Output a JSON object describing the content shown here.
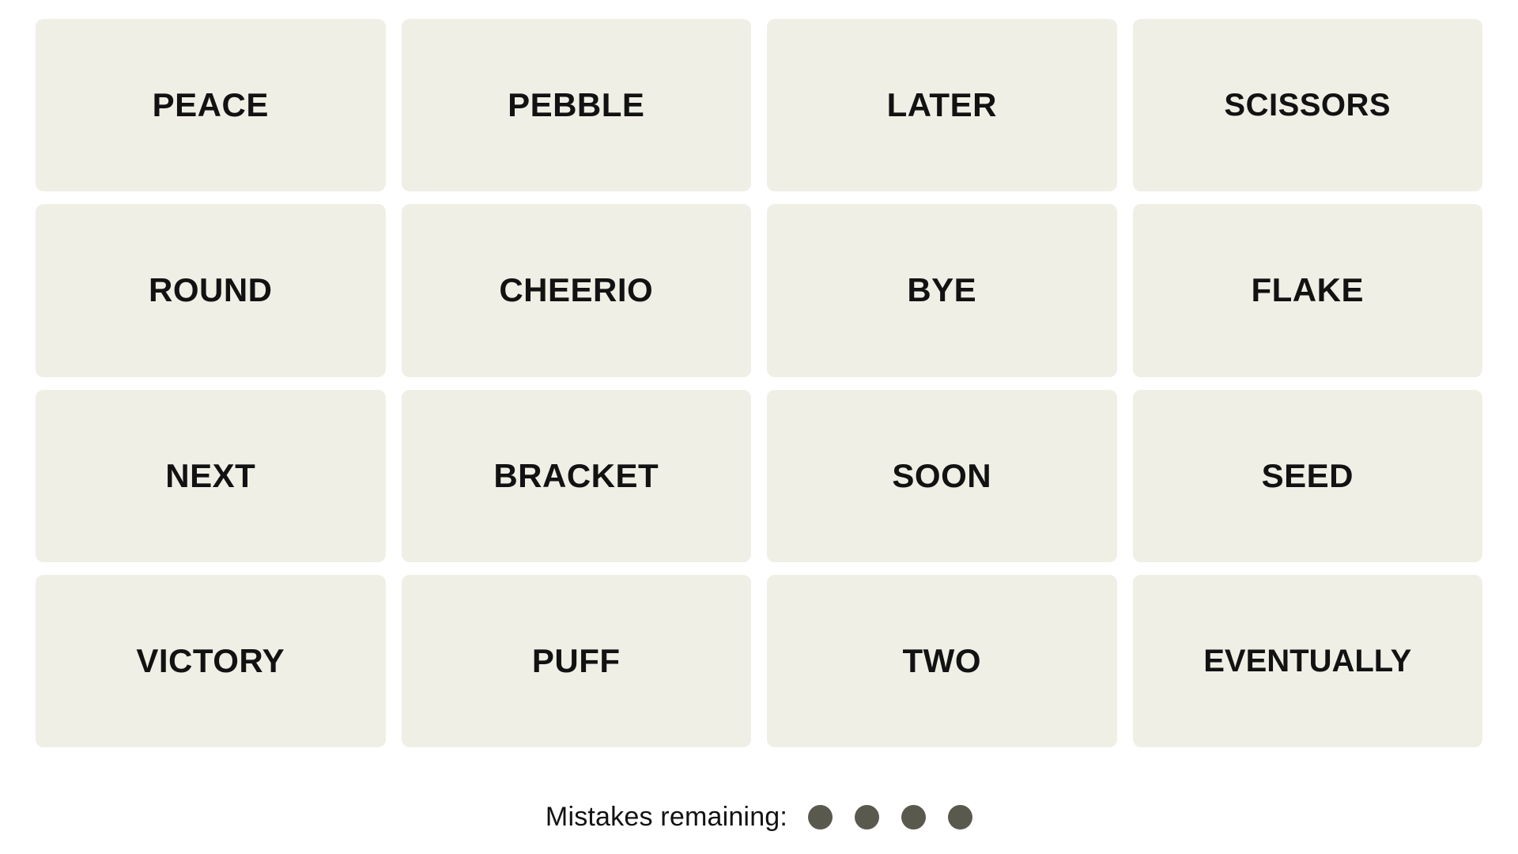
{
  "game": {
    "name": "Connections",
    "tile_background_color": "#efefe6",
    "tile_text_color": "#121212",
    "page_background_color": "#ffffff",
    "dot_color": "#5a594e"
  },
  "grid": {
    "rows": 4,
    "columns": 4,
    "tiles": [
      {
        "word": "PEACE"
      },
      {
        "word": "PEBBLE"
      },
      {
        "word": "LATER"
      },
      {
        "word": "SCISSORS"
      },
      {
        "word": "ROUND"
      },
      {
        "word": "CHEERIO"
      },
      {
        "word": "BYE"
      },
      {
        "word": "FLAKE"
      },
      {
        "word": "NEXT"
      },
      {
        "word": "BRACKET"
      },
      {
        "word": "SOON"
      },
      {
        "word": "SEED"
      },
      {
        "word": "VICTORY"
      },
      {
        "word": "PUFF"
      },
      {
        "word": "TWO"
      },
      {
        "word": "EVENTUALLY"
      }
    ]
  },
  "footer": {
    "mistakes_label": "Mistakes remaining:",
    "mistakes_remaining": 4,
    "dots": [
      {
        "state": "remaining"
      },
      {
        "state": "remaining"
      },
      {
        "state": "remaining"
      },
      {
        "state": "remaining"
      }
    ]
  }
}
